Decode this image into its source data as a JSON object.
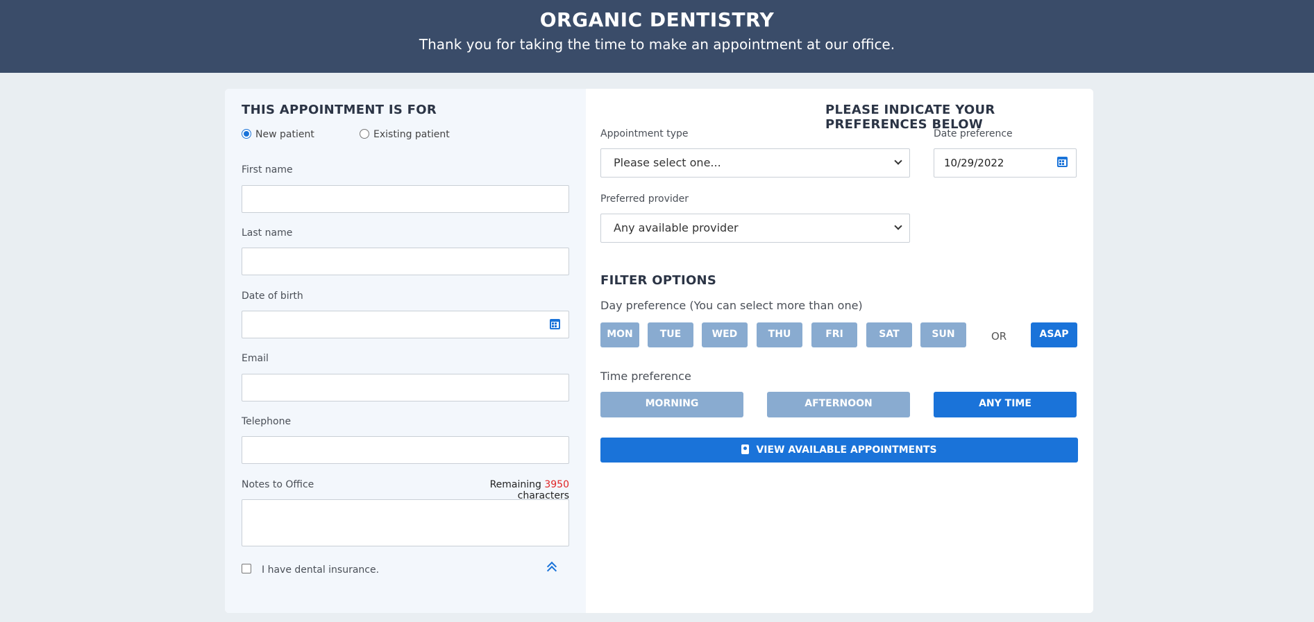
{
  "header": {
    "title": "ORGANIC DENTISTRY",
    "subtitle": "Thank you for taking the time to make an appointment at our office."
  },
  "left": {
    "section_title": "THIS APPOINTMENT IS FOR",
    "patient_options": [
      {
        "label": "New patient",
        "checked": true
      },
      {
        "label": "Existing patient",
        "checked": false
      }
    ],
    "fields": {
      "first_name": {
        "label": "First name",
        "value": ""
      },
      "last_name": {
        "label": "Last name",
        "value": ""
      },
      "dob": {
        "label": "Date of birth",
        "value": ""
      },
      "email": {
        "label": "Email",
        "value": ""
      },
      "telephone": {
        "label": "Telephone",
        "value": ""
      },
      "notes": {
        "label": "Notes to Office",
        "value": ""
      }
    },
    "remaining": {
      "prefix": "Remaining",
      "count": "3950",
      "suffix": "characters",
      "count_color": "#e02424"
    },
    "insurance_label": "I have dental insurance."
  },
  "right": {
    "section_title": "PLEASE INDICATE YOUR PREFERENCES BELOW",
    "appointment_type": {
      "label": "Appointment type",
      "value": "Please select one..."
    },
    "date_preference": {
      "label": "Date preference",
      "value": "10/29/2022"
    },
    "preferred_provider": {
      "label": "Preferred provider",
      "value": "Any available provider"
    },
    "filter_title": "FILTER OPTIONS",
    "day_pref_label": "Day preference (You can select more than one)",
    "days": [
      "MON",
      "TUE",
      "WED",
      "THU",
      "FRI",
      "SAT",
      "SUN"
    ],
    "or_label": "OR",
    "asap_label": "ASAP",
    "time_pref_label": "Time preference",
    "times": [
      "MORNING",
      "AFTERNOON",
      "ANY TIME"
    ],
    "view_button": "VIEW AVAILABLE APPOINTMENTS"
  },
  "colors": {
    "header_bg": "#3a4c69",
    "accent": "#1a73d9",
    "inactive_button": "#89abd0",
    "page_bg": "#e9eef2"
  }
}
